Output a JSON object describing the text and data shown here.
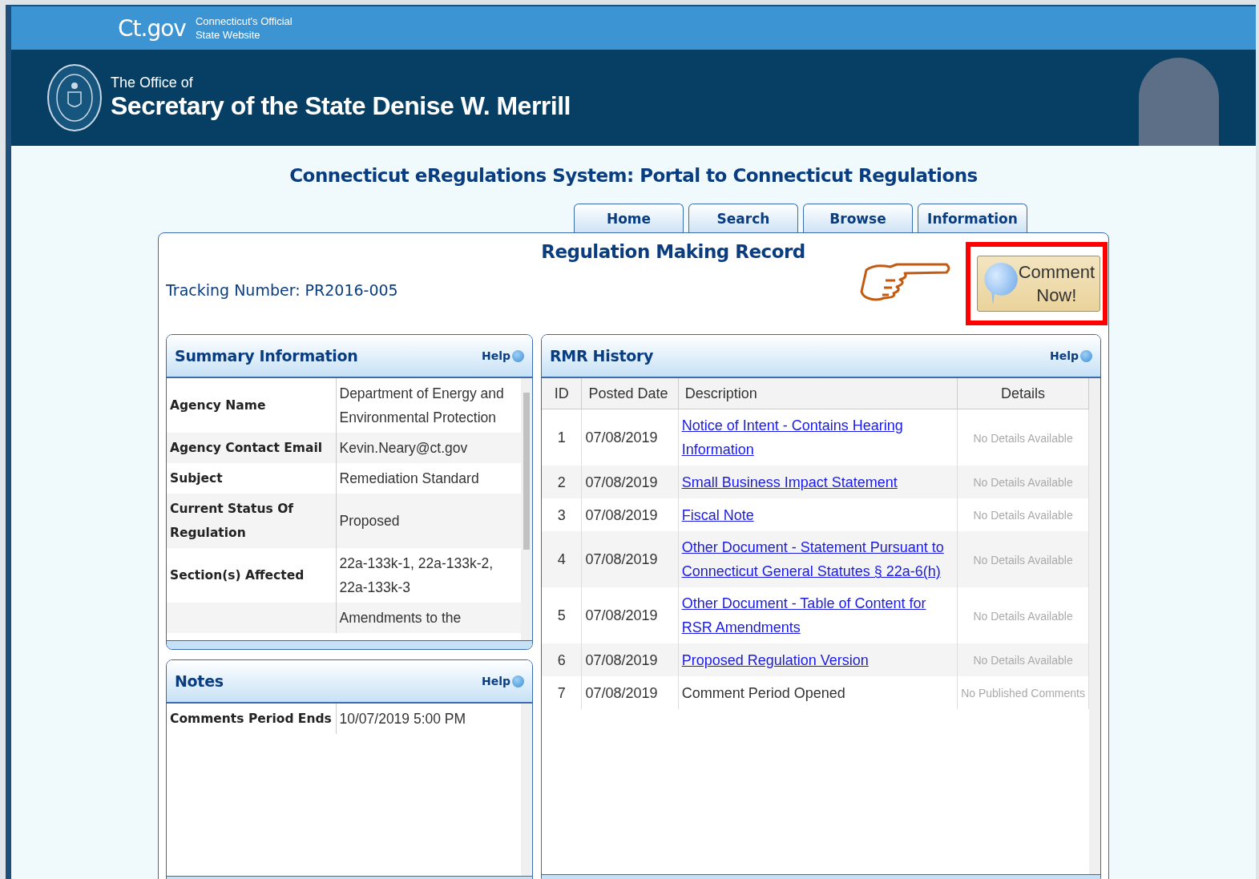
{
  "top_bar": {
    "logo": "Ct.gov",
    "tagline": [
      "Connecticut's Official",
      "State Website"
    ]
  },
  "header": {
    "pre_title": "The Office of",
    "title": "Secretary of the State Denise W. Merrill"
  },
  "page_title": "Connecticut eRegulations System: Portal to Connecticut Regulations",
  "tabs": [
    {
      "label": "Home",
      "selected": false
    },
    {
      "label": "Search",
      "selected": false
    },
    {
      "label": "Browse",
      "selected": false
    },
    {
      "label": "Information",
      "selected": false
    }
  ],
  "record": {
    "title": "Regulation Making Record",
    "tracking": "Tracking Number: PR2016-005",
    "comment_button": [
      "Comment",
      "Now!"
    ]
  },
  "summary": {
    "title": "Summary Information",
    "help": "Help",
    "rows": [
      {
        "label": "Agency Name",
        "value": "Department of Energy and Environmental Protection"
      },
      {
        "label": "Agency Contact Email",
        "value": "Kevin.Neary@ct.gov"
      },
      {
        "label": "Subject",
        "value": "Remediation Standard"
      },
      {
        "label": "Current Status Of Regulation",
        "value": "Proposed"
      },
      {
        "label": "Section(s) Affected",
        "value": "22a-133k-1, 22a-133k-2, 22a-133k-3"
      },
      {
        "label": "",
        "value": "Amendments to the"
      }
    ]
  },
  "notes": {
    "title": "Notes",
    "help": "Help",
    "rows": [
      {
        "label": "Comments Period Ends",
        "value": "10/07/2019 5:00 PM"
      }
    ]
  },
  "history": {
    "title": "RMR History",
    "help": "Help",
    "columns": [
      "ID",
      "Posted Date",
      "Description",
      "Details"
    ],
    "rows": [
      {
        "id": "1",
        "date": "07/08/2019",
        "description": "Notice of Intent - Contains Hearing Information",
        "kind": "link",
        "details": "No Details Available"
      },
      {
        "id": "2",
        "date": "07/08/2019",
        "description": "Small Business Impact Statement",
        "kind": "link",
        "details": "No Details Available"
      },
      {
        "id": "3",
        "date": "07/08/2019",
        "description": "Fiscal Note",
        "kind": "link",
        "details": "No Details Available"
      },
      {
        "id": "4",
        "date": "07/08/2019",
        "description": "Other Document - Statement Pursuant to Connecticut General Statutes § 22a-6(h)",
        "kind": "link",
        "details": "No Details Available"
      },
      {
        "id": "5",
        "date": "07/08/2019",
        "description": "Other Document - Table of Content for RSR Amendments",
        "kind": "link",
        "details": "No Details Available"
      },
      {
        "id": "6",
        "date": "07/08/2019",
        "description": "Proposed Regulation Version",
        "kind": "link",
        "details": "No Details Available"
      },
      {
        "id": "7",
        "date": "07/08/2019",
        "description": "Comment Period Opened",
        "kind": "text",
        "details": "No Published Comments"
      }
    ]
  }
}
